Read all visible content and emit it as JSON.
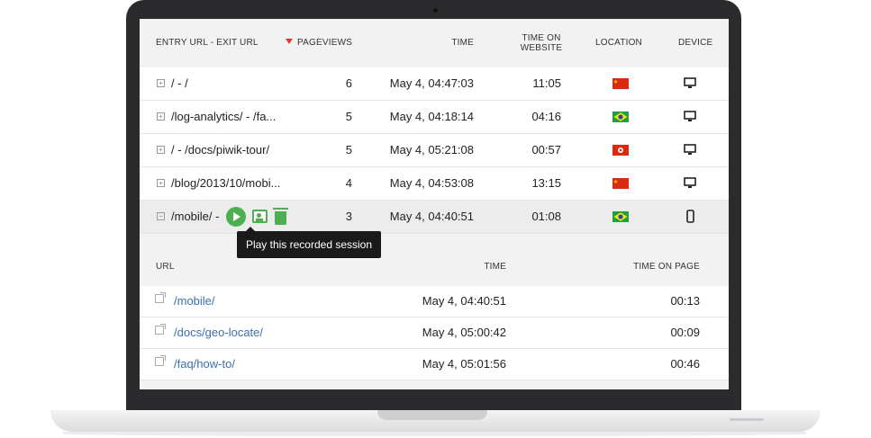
{
  "visits": {
    "headers": {
      "entry_exit": "ENTRY URL - EXIT URL",
      "pageviews": "PAGEVIEWS",
      "time": "TIME",
      "time_on_website": "TIME ON WEBSITE",
      "location": "LOCATION",
      "device": "DEVICE"
    },
    "rows": [
      {
        "url": "/ - /",
        "pageviews": "6",
        "time": "May 4, 04:47:03",
        "duration": "11:05",
        "flag": "china-flag-icon",
        "device": "desktop-icon"
      },
      {
        "url": "/log-analytics/ - /fa...",
        "pageviews": "5",
        "time": "May 4, 04:18:14",
        "duration": "04:16",
        "flag": "brazil-flag-icon",
        "device": "desktop-icon"
      },
      {
        "url": "/ - /docs/piwik-tour/",
        "pageviews": "5",
        "time": "May 4, 05:21:08",
        "duration": "00:57",
        "flag": "hong-kong-flag-icon",
        "device": "desktop-icon"
      },
      {
        "url": "/blog/2013/10/mobi...",
        "pageviews": "4",
        "time": "May 4, 04:53:08",
        "duration": "13:15",
        "flag": "china-flag-icon",
        "device": "desktop-icon"
      },
      {
        "url": "/mobile/ -",
        "pageviews": "3",
        "time": "May 4, 04:40:51",
        "duration": "01:08",
        "flag": "brazil-flag-icon",
        "device": "smartphone-icon"
      }
    ],
    "tooltip": "Play this recorded session"
  },
  "pages": {
    "headers": {
      "url": "URL",
      "time": "TIME",
      "time_on_page": "TIME ON PAGE"
    },
    "rows": [
      {
        "url": "/mobile/",
        "time": "May 4, 04:40:51",
        "time_on_page": "00:13"
      },
      {
        "url": "/docs/geo-locate/",
        "time": "May 4, 05:00:42",
        "time_on_page": "00:09"
      },
      {
        "url": "/faq/how-to/",
        "time": "May 4, 05:01:56",
        "time_on_page": "00:46"
      }
    ]
  },
  "colors": {
    "accent_green": "#4caf50",
    "link_blue": "#3a6fb0",
    "sort_arrow": "#e53935"
  }
}
